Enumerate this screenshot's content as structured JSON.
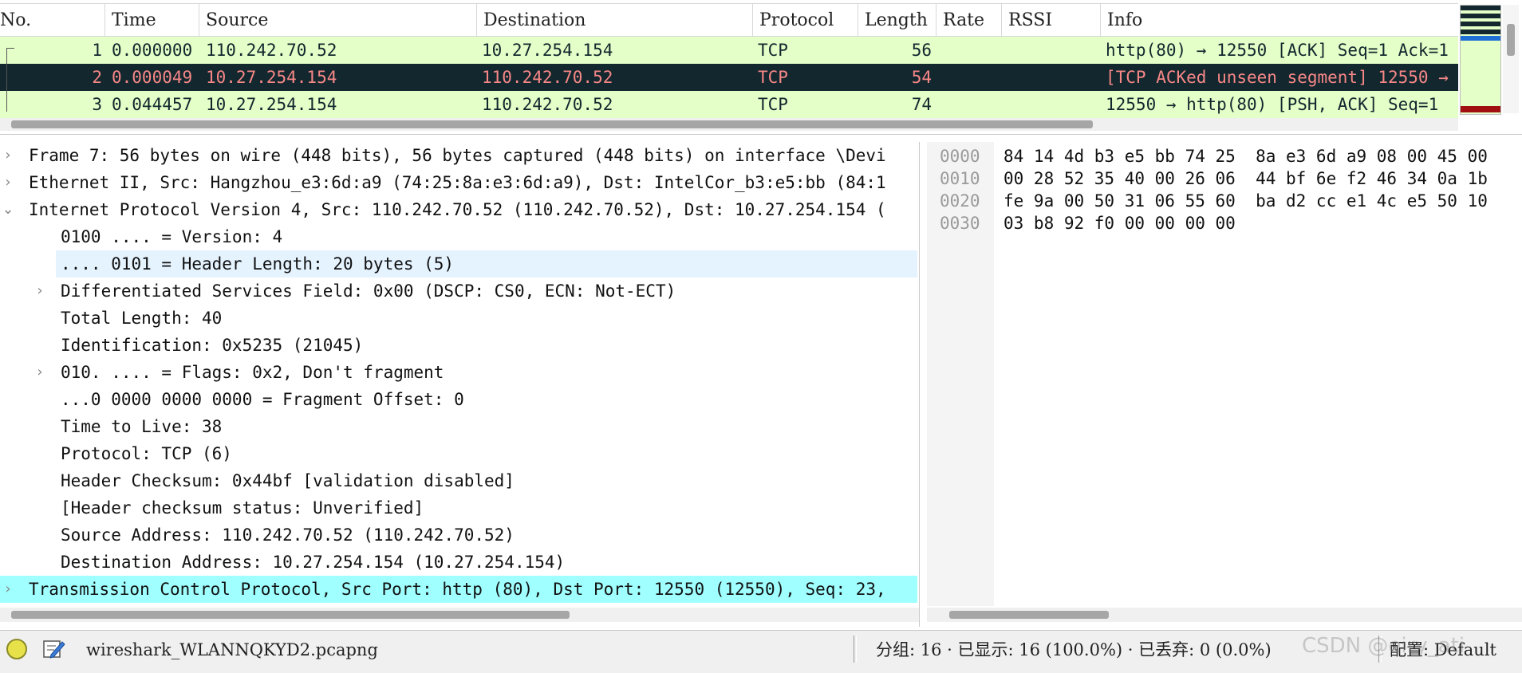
{
  "packet_list": {
    "columns": [
      "No.",
      "Time",
      "Source",
      "Destination",
      "Protocol",
      "Length",
      "Rate",
      "RSSI",
      "Info"
    ],
    "rows": [
      {
        "no": "1",
        "time": "0.000000",
        "source": "110.242.70.52",
        "destination": "10.27.254.154",
        "protocol": "TCP",
        "length": "56",
        "info": "http(80) → 12550 [ACK] Seq=1 Ack=1"
      },
      {
        "no": "2",
        "time": "0.000049",
        "source": "10.27.254.154",
        "destination": "110.242.70.52",
        "protocol": "TCP",
        "length": "54",
        "info": "[TCP ACKed unseen segment] 12550 →"
      },
      {
        "no": "3",
        "time": "0.044457",
        "source": "10.27.254.154",
        "destination": "110.242.70.52",
        "protocol": "TCP",
        "length": "74",
        "info": "12550 → http(80) [PSH, ACK] Seq=1"
      }
    ],
    "selected_row": 2
  },
  "details": {
    "rows": [
      {
        "text": "Frame 7: 56 bytes on wire (448 bits), 56 bytes captured (448 bits) on interface \\Devi",
        "arrow": "›"
      },
      {
        "text": "Ethernet II, Src: Hangzhou_e3:6d:a9 (74:25:8a:e3:6d:a9), Dst: IntelCor_b3:e5:bb (84:1",
        "arrow": "›"
      },
      {
        "text": "Internet Protocol Version 4, Src: 110.242.70.52 (110.242.70.52), Dst: 10.27.254.154 (",
        "arrow": "⌄"
      },
      {
        "text": "0100 .... = Version: 4",
        "arrow": ""
      },
      {
        "text": ".... 0101 = Header Length: 20 bytes (5)",
        "arrow": ""
      },
      {
        "text": "Differentiated Services Field: 0x00 (DSCP: CS0, ECN: Not-ECT)",
        "arrow": "›"
      },
      {
        "text": "Total Length: 40",
        "arrow": ""
      },
      {
        "text": "Identification: 0x5235 (21045)",
        "arrow": ""
      },
      {
        "text": "010. .... = Flags: 0x2, Don't fragment",
        "arrow": "›"
      },
      {
        "text": "...0 0000 0000 0000 = Fragment Offset: 0",
        "arrow": ""
      },
      {
        "text": "Time to Live: 38",
        "arrow": ""
      },
      {
        "text": "Protocol: TCP (6)",
        "arrow": ""
      },
      {
        "text": "Header Checksum: 0x44bf [validation disabled]",
        "arrow": ""
      },
      {
        "text": "[Header checksum status: Unverified]",
        "arrow": ""
      },
      {
        "text": "Source Address: 110.242.70.52 (110.242.70.52)",
        "arrow": ""
      },
      {
        "text": "Destination Address: 10.27.254.154 (10.27.254.154)",
        "arrow": ""
      },
      {
        "text": "Transmission Control Protocol, Src Port: http (80), Dst Port: 12550 (12550), Seq: 23,",
        "arrow": "›"
      }
    ]
  },
  "bytes": {
    "rows": [
      {
        "offset": "0000",
        "hex": "84 14 4d b3 e5 bb 74 25  8a e3 6d a9 08 00 45 00"
      },
      {
        "offset": "0010",
        "hex": "00 28 52 35 40 00 26 06  44 bf 6e f2 46 34 0a 1b"
      },
      {
        "offset": "0020",
        "hex": "fe 9a 00 50 31 06 55 60  ba d2 cc e1 4c e5 50 10"
      },
      {
        "offset": "0030",
        "hex": "03 b8 92 f0 00 00 00 00"
      }
    ]
  },
  "status": {
    "filename": "wireshark_WLANNQKYD2.pcapng",
    "packets": "分组: 16 · 已显示: 16 (100.0%) · 已丢弃: 0 (0.0%)",
    "profile": "配置: Default",
    "watermark": "CSDN @eiry_ati"
  },
  "colors": {
    "row_green": "#e4ffc7",
    "row_selected_bg": "#12272e",
    "row_selected_fg": "#f78787",
    "tcp_highlight": "#a0ffff",
    "field_highlight": "#e5f3ff"
  },
  "icons": {
    "status_led": "status-led-icon",
    "edit": "edit-comment-icon"
  }
}
